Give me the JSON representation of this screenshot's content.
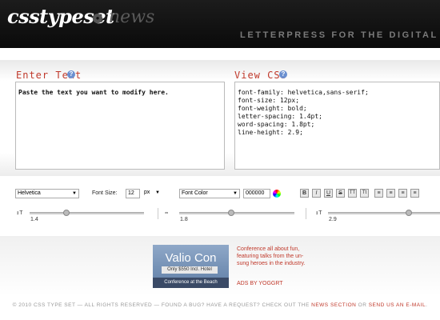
{
  "header": {
    "logo": "csstypeset",
    "logo_news": "news",
    "tagline": "LETTERPRESS FOR THE DIGITAL A"
  },
  "enter_text": {
    "title": "Enter Text",
    "content": "Paste the text you want to modify here."
  },
  "view_css": {
    "title": "View CSS",
    "lines": [
      "font-family: helvetica,sans-serif;",
      "font-size: 12px;",
      "font-weight: bold;",
      "letter-spacing: 1.4pt;",
      "word-spacing: 1.8pt;",
      "line-height: 2.9;"
    ]
  },
  "toolbar": {
    "font_family": "Helvetica",
    "font_size_label": "Font Size:",
    "font_size_value": "12",
    "font_size_unit": "px",
    "font_color_label": "Font Color",
    "font_color_value": "000000",
    "format_buttons": [
      "B",
      "I",
      "U",
      "S",
      "TT",
      "Tt",
      "≡",
      "≡",
      "≡",
      "≡"
    ]
  },
  "sliders": [
    {
      "icon": "letter-spacing-icon",
      "value": "1.4",
      "level": 0.32
    },
    {
      "icon": "word-spacing-icon",
      "value": "1.8",
      "level": 0.45
    },
    {
      "icon": "line-height-icon",
      "value": "2.9",
      "level": 0.72
    }
  ],
  "ad": {
    "title": "Valio Con",
    "price": "Only $550 Incl. Hotel",
    "subtitle": "Conference at the Beach",
    "description": "Conference all about fun, featuring talks from the un-sung heroes in the industry.",
    "ads_by": "ADS BY YOGGRT"
  },
  "footer": {
    "text": "© 2010 CSS TYPE SET — ALL RIGHTS RESERVED — FOUND A BUG? HAVE A REQUEST? CHECK OUT THE",
    "news_link": "NEWS SECTION",
    "or": "OR",
    "email_link": "SEND US AN E-MAIL",
    "end": "."
  },
  "colors": {
    "accent": "#c0392b",
    "header_bg": "#111111"
  }
}
